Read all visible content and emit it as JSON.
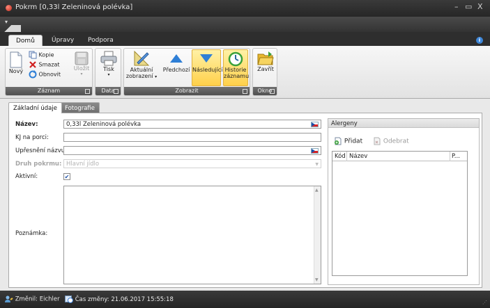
{
  "window": {
    "title": "Pokrm [0,33l Zeleninová polévka]",
    "controls": [
      "–",
      "▭",
      "X"
    ]
  },
  "ribbon_tabs": [
    {
      "label": "Domů",
      "active": true
    },
    {
      "label": "Úpravy",
      "active": false
    },
    {
      "label": "Podpora",
      "active": false
    }
  ],
  "ribbon": {
    "zaznam": {
      "label": "Záznam",
      "novy": "Nový",
      "kopie": "Kopie",
      "smazat": "Smazat",
      "obnovit": "Obnovit",
      "ulozit": "Uložit"
    },
    "data": {
      "label": "Data",
      "tisk": "Tisk"
    },
    "zobrazit": {
      "label": "Zobrazit",
      "aktualni_1": "Aktuální",
      "aktualni_2": "zobrazení",
      "predchozi": "Předchozí",
      "nasledujici": "Následující",
      "historie_1": "Historie",
      "historie_2": "záznamu"
    },
    "okno": {
      "label": "Okno",
      "zavrit": "Zavřít"
    }
  },
  "content_tabs": [
    {
      "label": "Základní údaje",
      "active": true
    },
    {
      "label": "Fotografie",
      "active": false
    }
  ],
  "form": {
    "nazev_label": "Název:",
    "nazev_value": "0,33l Zeleninová polévka",
    "kj_label": "KJ na porci:",
    "kj_value": "",
    "upresneni_label": "Upřesnění názvu:",
    "upresneni_value": "",
    "druh_label": "Druh pokrmu:",
    "druh_value": "Hlavní jídlo",
    "aktivni_label": "Aktivní:",
    "aktivni_checked": true,
    "poznamka_label": "Poznámka:",
    "poznamka_value": ""
  },
  "allergens": {
    "title": "Alergeny",
    "pridat": "Přidat",
    "odebrat": "Odebrat",
    "columns": [
      "Kód",
      "Název",
      "P..."
    ],
    "rows": []
  },
  "status": {
    "zmenil": "Změnil: Eichler",
    "cas": "Čas změny: 21.06.2017 15:55:18"
  }
}
